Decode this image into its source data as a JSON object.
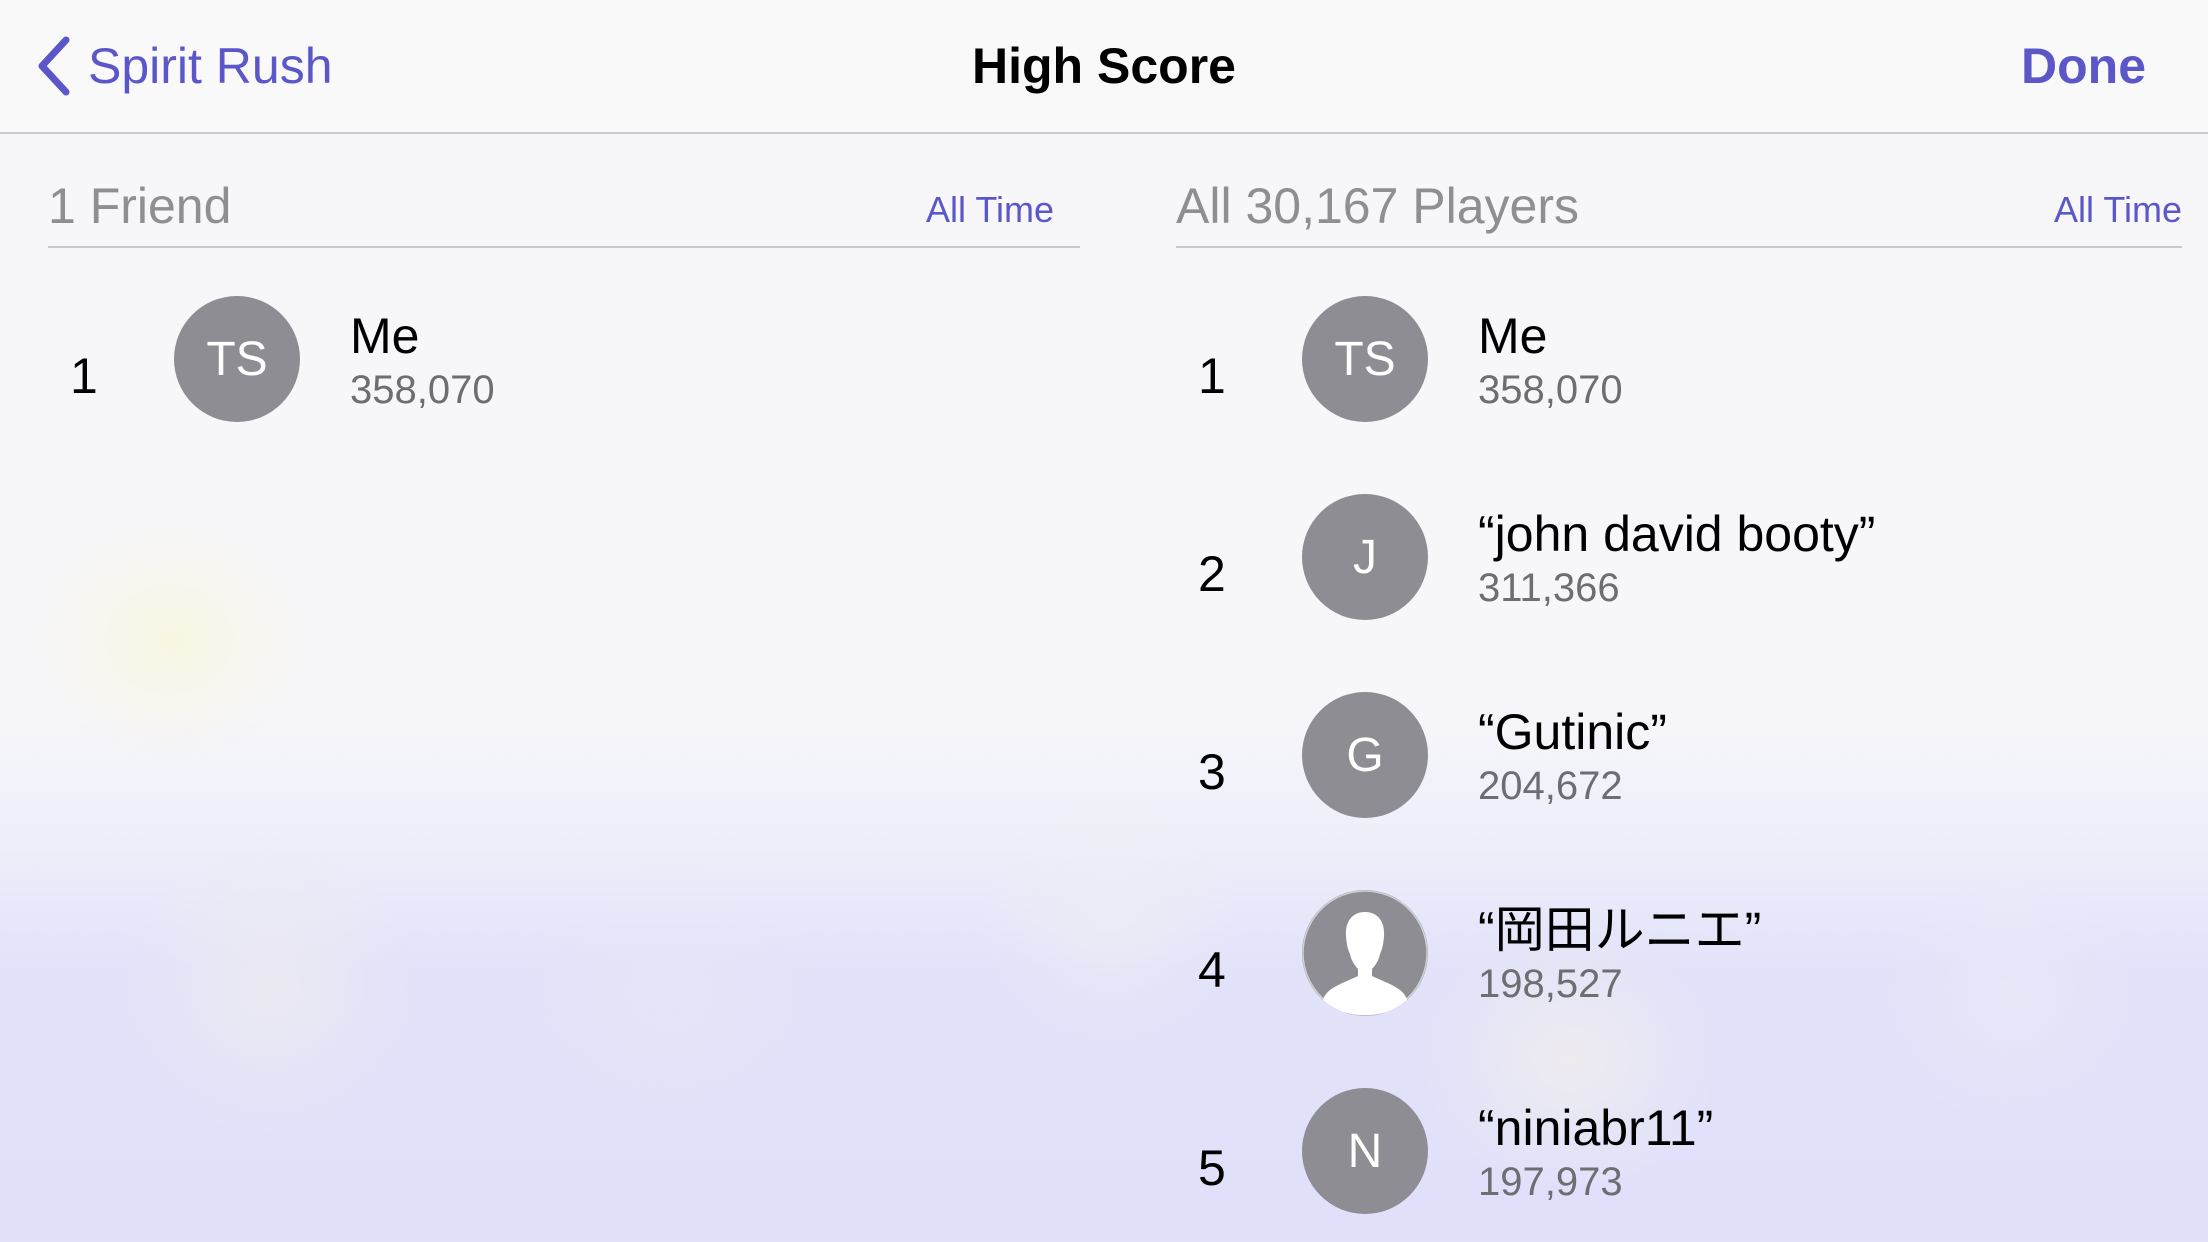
{
  "nav": {
    "back_label": "Spirit Rush",
    "title": "High Score",
    "done_label": "Done"
  },
  "friends": {
    "title": "1 Friend",
    "filter": "All Time",
    "entries": [
      {
        "rank": "1",
        "initials": "TS",
        "name": "Me",
        "score": "358,070"
      }
    ]
  },
  "all_players": {
    "title": "All 30,167 Players",
    "filter": "All Time",
    "entries": [
      {
        "rank": "1",
        "initials": "TS",
        "name": "Me",
        "score": "358,070"
      },
      {
        "rank": "2",
        "initials": "J",
        "name": "“john david booty”",
        "score": "311,366"
      },
      {
        "rank": "3",
        "initials": "G",
        "name": "“Gutinic”",
        "score": "204,672"
      },
      {
        "rank": "4",
        "initials": "",
        "avatar_icon": "person-silhouette-icon",
        "name": "“岡田ルニエ”",
        "score": "198,527"
      },
      {
        "rank": "5",
        "initials": "N",
        "name": "“niniabr11”",
        "score": "197,973"
      }
    ]
  },
  "colors": {
    "accent": "#5b57c9",
    "avatar_bg": "#8e8d93",
    "secondary_text": "#8e8e93"
  }
}
